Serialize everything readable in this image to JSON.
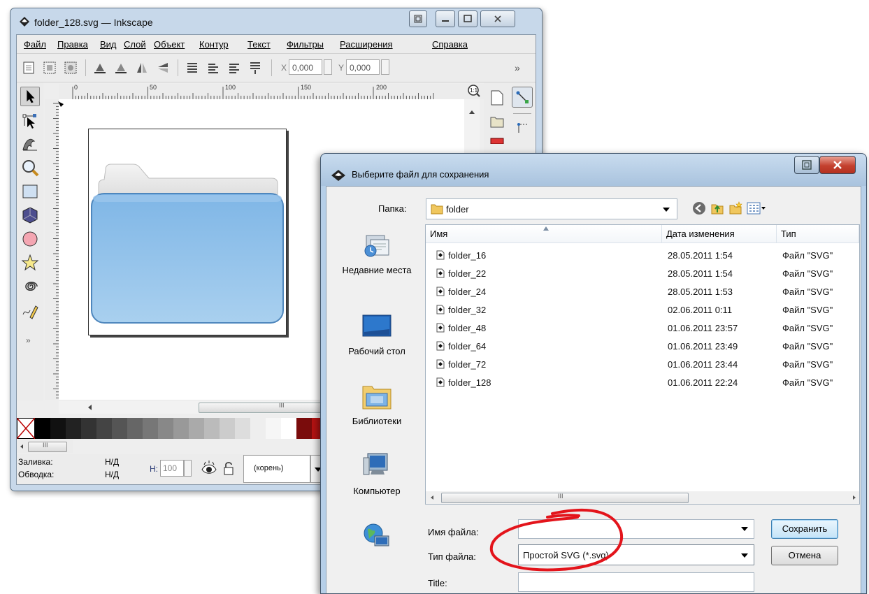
{
  "inkscape": {
    "title": "folder_128.svg — Inkscape",
    "menu": [
      "Файл",
      "Правка",
      "Вид",
      "Слой",
      "Объект",
      "Контур",
      "Текст",
      "Фильтры",
      "Расширения",
      "Справка"
    ],
    "coords": {
      "x_label": "X",
      "x_value": "0,000",
      "y_label": "Y",
      "y_value": "0,000"
    },
    "more": "»",
    "ruler_ticks": [
      "0",
      "50",
      "100",
      "150",
      "200"
    ],
    "ruler_left_ticks": [
      "1\n0\n0",
      "5\n0",
      "0"
    ],
    "status": {
      "fill_label": "Заливка:",
      "fill_value": "Н/Д",
      "stroke_label": "Обводка:",
      "stroke_value": "Н/Д",
      "h_label": "H:",
      "h_value": "100",
      "layer": "(корень)"
    },
    "scroll_grip": "III",
    "palette_scroll_grip": "III"
  },
  "dialog": {
    "title": "Выберите файл для сохранения",
    "lookin_label": "Папка:",
    "lookin_value": "folder",
    "places": [
      "Недавние места",
      "Рабочий стол",
      "Библиотеки",
      "Компьютер"
    ],
    "columns": {
      "name": "Имя",
      "date": "Дата изменения",
      "type": "Тип"
    },
    "files": [
      {
        "name": "folder_16",
        "date": "28.05.2011 1:54",
        "type": "Файл \"SVG\""
      },
      {
        "name": "folder_22",
        "date": "28.05.2011 1:54",
        "type": "Файл \"SVG\""
      },
      {
        "name": "folder_24",
        "date": "28.05.2011 1:53",
        "type": "Файл \"SVG\""
      },
      {
        "name": "folder_32",
        "date": "02.06.2011 0:11",
        "type": "Файл \"SVG\""
      },
      {
        "name": "folder_48",
        "date": "01.06.2011 23:57",
        "type": "Файл \"SVG\""
      },
      {
        "name": "folder_64",
        "date": "01.06.2011 23:49",
        "type": "Файл \"SVG\""
      },
      {
        "name": "folder_72",
        "date": "01.06.2011 23:44",
        "type": "Файл \"SVG\""
      },
      {
        "name": "folder_128",
        "date": "01.06.2011 22:24",
        "type": "Файл \"SVG\""
      }
    ],
    "filename_label": "Имя файла:",
    "filename_value": "",
    "filetype_label": "Тип файла:",
    "filetype_value": "Простой SVG (*.svg)",
    "title_label": "Title:",
    "title_value": "",
    "save_button": "Сохранить",
    "cancel_button": "Отмена",
    "scroll_grip": "III"
  },
  "colors": {
    "annotation": "#e3141b",
    "titlebar": "#c7d8ea",
    "close_button": "#c9463d",
    "folder_blue": "#6aa5d9"
  }
}
